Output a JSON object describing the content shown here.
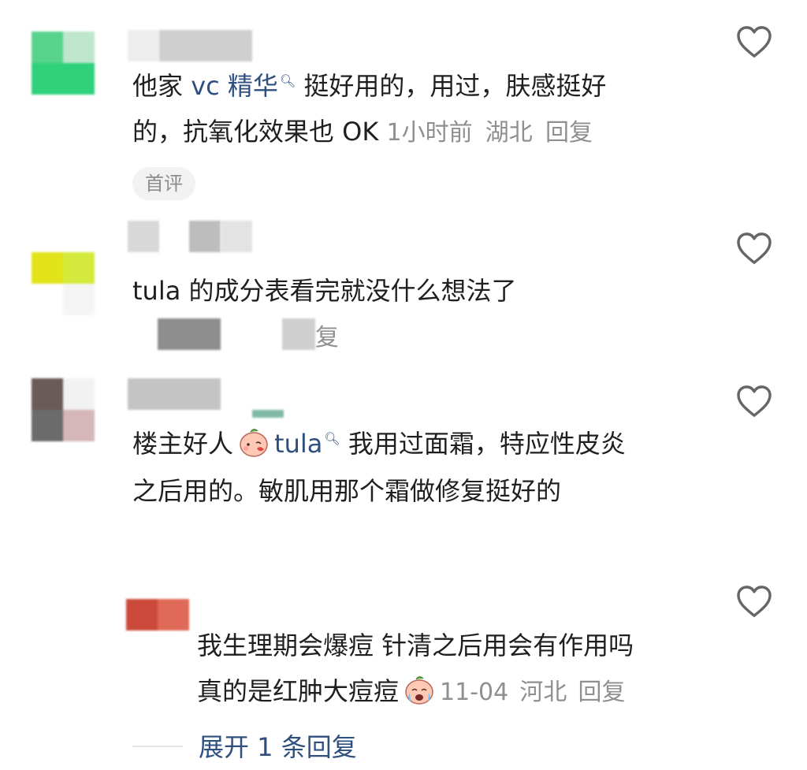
{
  "comments": [
    {
      "segments": {
        "pre": "他家 ",
        "link": "vc 精华",
        "post1": " 挺好用的，用过，肤感挺好",
        "line2": "的，抗氧化效果也 OK "
      },
      "time": "1小时前",
      "location": "湖北",
      "reply": "回复",
      "badge": "首评"
    },
    {
      "text": "tula 的成分表看完就没什么想法了",
      "reply_fragment": "复"
    },
    {
      "segments": {
        "pre": "楼主好人",
        "link": "tula",
        "post1": "  我用过面霜，特应性皮炎",
        "line2": "之后用的。敏肌用那个霜做修复挺好的"
      }
    }
  ],
  "reply": {
    "line1": "我生理期会爆痘 针清之后用会有作用吗",
    "line2": "真的是红肿大痘痘",
    "date": "11-04",
    "location": "河北",
    "reply": "回复",
    "expand": "展开 1 条回复"
  },
  "icons": {
    "heart": "heart-icon",
    "search": "search-icon",
    "emoji_smile": "emoji-blush-icon",
    "emoji_cry": "emoji-cry-icon"
  },
  "colors": {
    "link": "#2f4f7f",
    "meta": "#8f8f8f",
    "text": "#1f1f1f"
  }
}
